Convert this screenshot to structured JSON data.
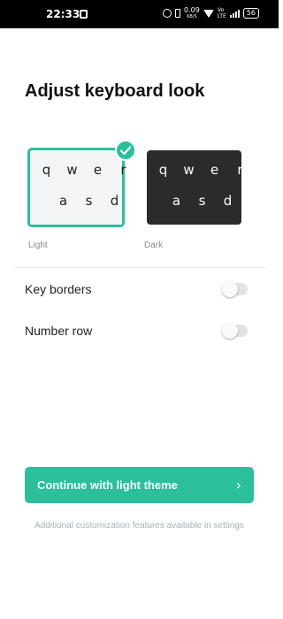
{
  "status_bar": {
    "time": "22:33",
    "net_speed_value": "0.09",
    "net_speed_unit": "KB/S",
    "volte_top": "Vo",
    "volte_bottom": "LTE",
    "battery": "56"
  },
  "page": {
    "title": "Adjust keyboard look"
  },
  "themes": [
    {
      "label": "Light",
      "selected": true,
      "row1": [
        "q",
        "w",
        "e",
        "r"
      ],
      "row2": [
        "a",
        "s",
        "d"
      ]
    },
    {
      "label": "Dark",
      "selected": false,
      "row1": [
        "q",
        "w",
        "e",
        "r"
      ],
      "row2": [
        "a",
        "s",
        "d"
      ]
    }
  ],
  "settings": {
    "key_borders": {
      "label": "Key borders",
      "enabled": false
    },
    "number_row": {
      "label": "Number row",
      "enabled": false
    }
  },
  "actions": {
    "continue_label": "Continue with light theme",
    "continue_icon": "chevron-right-icon"
  },
  "footer": {
    "note": "Additional customization features available in settings"
  },
  "colors": {
    "accent": "#2bbf9c",
    "dark_keyboard": "#2b2b2b",
    "light_keyboard": "#f3f4f6"
  }
}
